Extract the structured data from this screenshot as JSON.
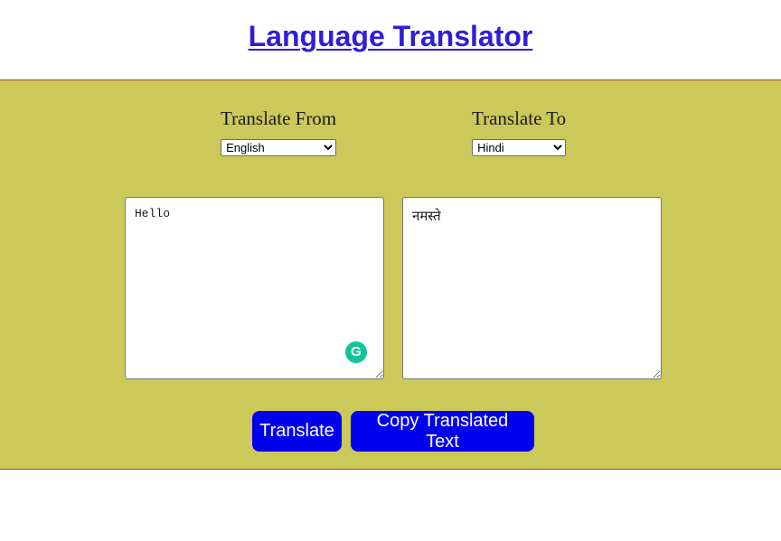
{
  "header": {
    "title": "Language Translator"
  },
  "from": {
    "label": "Translate From",
    "selected": "English"
  },
  "to": {
    "label": "Translate To",
    "selected": "Hindi"
  },
  "source": {
    "value": "Hello"
  },
  "target": {
    "value": "नमस्ते"
  },
  "grammarly": {
    "icon": "grammarly-icon",
    "glyph": "G",
    "color": "#15c39a"
  },
  "buttons": {
    "translate_label": "Translate",
    "copy_label": "Copy Translated Text"
  },
  "colors": {
    "panel_bg": "#cbc95a",
    "panel_border": "#c23b3b",
    "title": "#2e1fd6",
    "button_bg": "#0000ee"
  }
}
